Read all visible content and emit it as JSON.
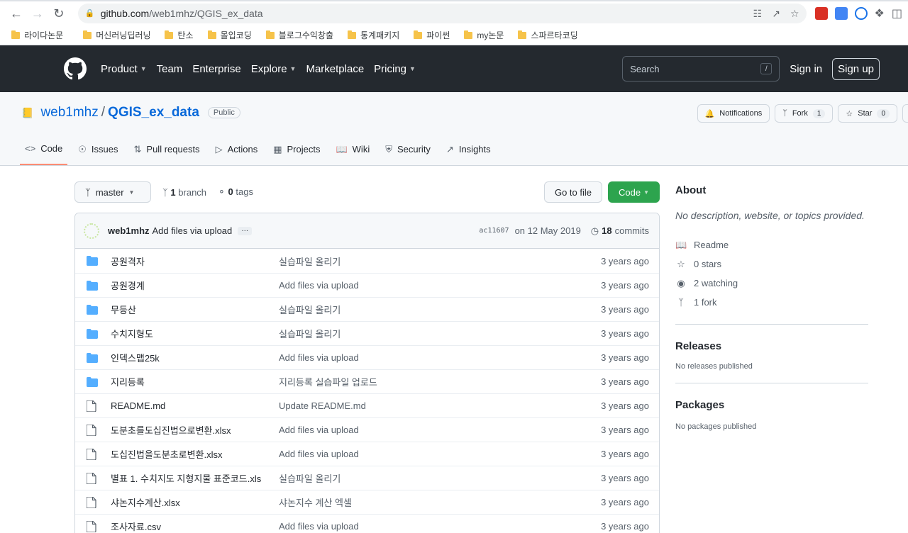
{
  "browser": {
    "url_host": "github.com",
    "url_path": "/web1mhz/QGIS_ex_data",
    "bookmarks": [
      "라이다논문",
      "머신러닝딥러닝",
      "탄소",
      "몰입코딩",
      "블로그수익창출",
      "통계패키지",
      "파이썬",
      "my논문",
      "스파르타코딩"
    ]
  },
  "header": {
    "nav": [
      "Product",
      "Team",
      "Enterprise",
      "Explore",
      "Marketplace",
      "Pricing"
    ],
    "search_placeholder": "Search",
    "search_key": "/",
    "signin": "Sign in",
    "signup": "Sign up"
  },
  "repo": {
    "owner": "web1mhz",
    "sep": "/",
    "name": "QGIS_ex_data",
    "visibility": "Public",
    "notifications": "Notifications",
    "fork_label": "Fork",
    "fork_count": "1",
    "star_label": "Star",
    "star_count": "0",
    "tabs": [
      "Code",
      "Issues",
      "Pull requests",
      "Actions",
      "Projects",
      "Wiki",
      "Security",
      "Insights"
    ]
  },
  "filenav": {
    "branch": "master",
    "branch_count": "1",
    "branch_word": "branch",
    "tag_count": "0",
    "tag_word": "tags",
    "goto": "Go to file",
    "code": "Code"
  },
  "commit": {
    "author": "web1mhz",
    "message": "Add files via upload",
    "ellipsis": "…",
    "sha": "ac11607",
    "date": "on 12 May 2019",
    "count": "18",
    "count_word": "commits"
  },
  "files": [
    {
      "type": "dir",
      "name": "공원격자",
      "msg": "실습파일 올리기",
      "age": "3 years ago"
    },
    {
      "type": "dir",
      "name": "공원경계",
      "msg": "Add files via upload",
      "age": "3 years ago"
    },
    {
      "type": "dir",
      "name": "무등산",
      "msg": "실습파일 올리기",
      "age": "3 years ago"
    },
    {
      "type": "dir",
      "name": "수치지형도",
      "msg": "실습파일 올리기",
      "age": "3 years ago"
    },
    {
      "type": "dir",
      "name": "인덱스맵25k",
      "msg": "Add files via upload",
      "age": "3 years ago"
    },
    {
      "type": "dir",
      "name": "지리등록",
      "msg": "지리등록 실습파일 업로드",
      "age": "3 years ago"
    },
    {
      "type": "file",
      "name": "README.md",
      "msg": "Update README.md",
      "age": "3 years ago"
    },
    {
      "type": "file",
      "name": "도분초를도십진법으로변환.xlsx",
      "msg": "Add files via upload",
      "age": "3 years ago"
    },
    {
      "type": "file",
      "name": "도십진법을도분초로변환.xlsx",
      "msg": "Add files via upload",
      "age": "3 years ago"
    },
    {
      "type": "file",
      "name": "별표 1. 수치지도 지형지물 표준코드.xls",
      "msg": "실습파일 올리기",
      "age": "3 years ago"
    },
    {
      "type": "file",
      "name": "샤논지수계산.xlsx",
      "msg": "샤논지수 계산 엑셀",
      "age": "3 years ago"
    },
    {
      "type": "file",
      "name": "조사자료.csv",
      "msg": "Add files via upload",
      "age": "3 years ago"
    }
  ],
  "about": {
    "title": "About",
    "desc": "No description, website, or topics provided.",
    "readme": "Readme",
    "stars": "0 stars",
    "watching": "2 watching",
    "forks": "1 fork",
    "releases_title": "Releases",
    "releases_text": "No releases published",
    "packages_title": "Packages",
    "packages_text": "No packages published"
  }
}
